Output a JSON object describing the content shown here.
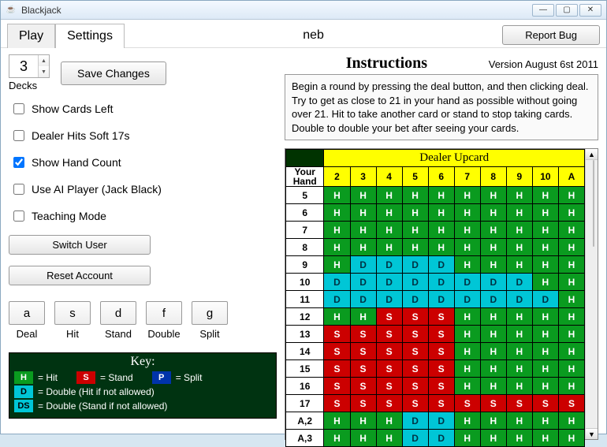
{
  "window": {
    "title": "Blackjack",
    "min": "—",
    "max": "▢",
    "close": "✕"
  },
  "tabs": {
    "play": "Play",
    "settings": "Settings"
  },
  "username": "neb",
  "report_bug": "Report Bug",
  "decks": {
    "value": "3",
    "label": "Decks"
  },
  "save_changes": "Save Changes",
  "checkboxes": {
    "show_cards_left": {
      "label": "Show Cards Left",
      "checked": false
    },
    "dealer_hits_soft_17": {
      "label": "Dealer Hits Soft 17s",
      "checked": false
    },
    "show_hand_count": {
      "label": "Show Hand Count",
      "checked": true
    },
    "use_ai_player": {
      "label": "Use AI Player (Jack Black)",
      "checked": false
    },
    "teaching_mode": {
      "label": "Teaching Mode",
      "checked": false
    }
  },
  "switch_user": "Switch User",
  "reset_account": "Reset Account",
  "hotkeys": [
    {
      "key": "a",
      "label": "Deal"
    },
    {
      "key": "s",
      "label": "Hit"
    },
    {
      "key": "d",
      "label": "Stand"
    },
    {
      "key": "f",
      "label": "Double"
    },
    {
      "key": "g",
      "label": "Split"
    }
  ],
  "key_legend": {
    "title": "Key:",
    "H": "= Hit",
    "S": "= Stand",
    "P": "= Split",
    "D": "= Double (Hit if not allowed)",
    "DS": "= Double (Stand if not allowed)"
  },
  "instructions": {
    "title": "Instructions",
    "version": "Version August 6st 2011",
    "text": "Begin a round by pressing the deal button, and then clicking deal. Try to get as close to 21 in your hand as possible without going over 21. Hit to take another card or stand to stop taking cards. Double to double your bet after seeing your cards."
  },
  "chart": {
    "dealer_title": "Dealer Upcard",
    "your_hand_title": "Your Hand"
  },
  "chart_data": {
    "type": "table",
    "dealer_cards": [
      "2",
      "3",
      "4",
      "5",
      "6",
      "7",
      "8",
      "9",
      "10",
      "A"
    ],
    "rows": [
      {
        "hand": "5",
        "cells": [
          "H",
          "H",
          "H",
          "H",
          "H",
          "H",
          "H",
          "H",
          "H",
          "H"
        ]
      },
      {
        "hand": "6",
        "cells": [
          "H",
          "H",
          "H",
          "H",
          "H",
          "H",
          "H",
          "H",
          "H",
          "H"
        ]
      },
      {
        "hand": "7",
        "cells": [
          "H",
          "H",
          "H",
          "H",
          "H",
          "H",
          "H",
          "H",
          "H",
          "H"
        ]
      },
      {
        "hand": "8",
        "cells": [
          "H",
          "H",
          "H",
          "H",
          "H",
          "H",
          "H",
          "H",
          "H",
          "H"
        ]
      },
      {
        "hand": "9",
        "cells": [
          "H",
          "D",
          "D",
          "D",
          "D",
          "H",
          "H",
          "H",
          "H",
          "H"
        ]
      },
      {
        "hand": "10",
        "cells": [
          "D",
          "D",
          "D",
          "D",
          "D",
          "D",
          "D",
          "D",
          "H",
          "H"
        ]
      },
      {
        "hand": "11",
        "cells": [
          "D",
          "D",
          "D",
          "D",
          "D",
          "D",
          "D",
          "D",
          "D",
          "H"
        ]
      },
      {
        "hand": "12",
        "cells": [
          "H",
          "H",
          "S",
          "S",
          "S",
          "H",
          "H",
          "H",
          "H",
          "H"
        ]
      },
      {
        "hand": "13",
        "cells": [
          "S",
          "S",
          "S",
          "S",
          "S",
          "H",
          "H",
          "H",
          "H",
          "H"
        ]
      },
      {
        "hand": "14",
        "cells": [
          "S",
          "S",
          "S",
          "S",
          "S",
          "H",
          "H",
          "H",
          "H",
          "H"
        ]
      },
      {
        "hand": "15",
        "cells": [
          "S",
          "S",
          "S",
          "S",
          "S",
          "H",
          "H",
          "H",
          "H",
          "H"
        ]
      },
      {
        "hand": "16",
        "cells": [
          "S",
          "S",
          "S",
          "S",
          "S",
          "H",
          "H",
          "H",
          "H",
          "H"
        ]
      },
      {
        "hand": "17",
        "cells": [
          "S",
          "S",
          "S",
          "S",
          "S",
          "S",
          "S",
          "S",
          "S",
          "S"
        ]
      },
      {
        "hand": "A,2",
        "cells": [
          "H",
          "H",
          "H",
          "D",
          "D",
          "H",
          "H",
          "H",
          "H",
          "H"
        ]
      },
      {
        "hand": "A,3",
        "cells": [
          "H",
          "H",
          "H",
          "D",
          "D",
          "H",
          "H",
          "H",
          "H",
          "H"
        ]
      }
    ]
  }
}
